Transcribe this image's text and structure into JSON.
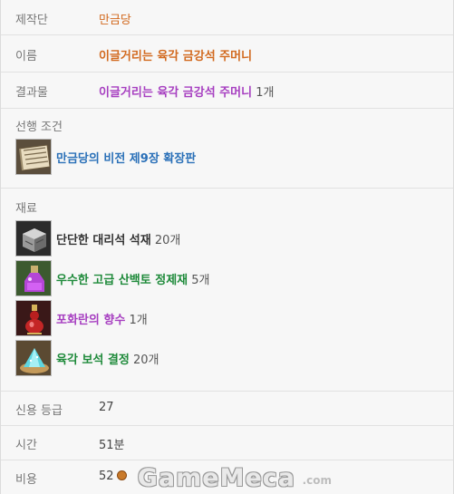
{
  "producer": {
    "label": "제작단",
    "value": "만금당"
  },
  "name": {
    "label": "이름",
    "value": "이글거리는 육각 금강석 주머니"
  },
  "result": {
    "label": "결과물",
    "value": "이글거리는 육각 금강석 주머니",
    "count": "1개"
  },
  "prerequisite": {
    "title": "선행 조건",
    "item": "만금당의 비전 제9장 확장판"
  },
  "materials": {
    "title": "재료",
    "items": [
      {
        "name": "단단한 대리석 석재",
        "count": "20개"
      },
      {
        "name": "우수한 고급 산백토 정제재",
        "count": "5개"
      },
      {
        "name": "포화란의 향수",
        "count": "1개"
      },
      {
        "name": "육각 보석 결정",
        "count": "20개"
      }
    ]
  },
  "credit": {
    "label": "신용 등급",
    "value": "27"
  },
  "time": {
    "label": "시간",
    "value": "51분"
  },
  "cost": {
    "label": "비용",
    "value": "52",
    "icon": "copper-coin-icon"
  },
  "watermark": {
    "brand": "GameMeca",
    "domain": ".com"
  }
}
